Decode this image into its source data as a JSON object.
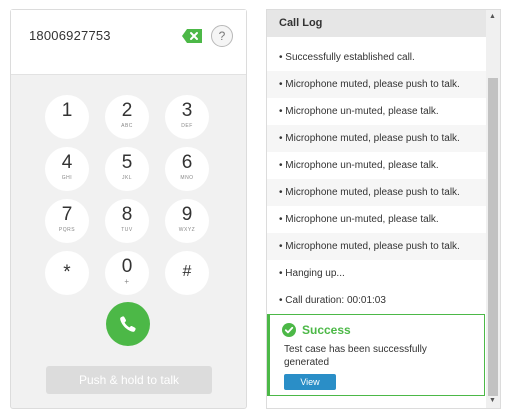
{
  "dialer": {
    "number": "18006927753",
    "help_label": "?",
    "keys": [
      {
        "digit": "1",
        "letters": ""
      },
      {
        "digit": "2",
        "letters": "ABC"
      },
      {
        "digit": "3",
        "letters": "DEF"
      },
      {
        "digit": "4",
        "letters": "GHI"
      },
      {
        "digit": "5",
        "letters": "JKL"
      },
      {
        "digit": "6",
        "letters": "MNO"
      },
      {
        "digit": "7",
        "letters": "PQRS"
      },
      {
        "digit": "8",
        "letters": "TUV"
      },
      {
        "digit": "9",
        "letters": "WXYZ"
      },
      {
        "digit": "*",
        "letters": ""
      },
      {
        "digit": "0",
        "letters": "+"
      },
      {
        "digit": "#",
        "letters": ""
      }
    ],
    "push_to_talk": "Push & hold to talk",
    "call_color": "#4cb847"
  },
  "call_log": {
    "title": "Call Log",
    "entries": [
      "• Successfully established call.",
      "• Microphone muted, please push to talk.",
      "• Microphone un-muted, please talk.",
      "• Microphone muted, please push to talk.",
      "• Microphone un-muted, please talk.",
      "• Microphone muted, please push to talk.",
      "• Microphone un-muted, please talk.",
      "• Microphone muted, please push to talk.",
      "• Hanging up...",
      "• Call duration: 00:01:03"
    ]
  },
  "toast": {
    "title": "Success",
    "message": "Test case has been successfully generated",
    "view_label": "View",
    "accent": "#4cb847",
    "button_color": "#2a8ec7"
  }
}
